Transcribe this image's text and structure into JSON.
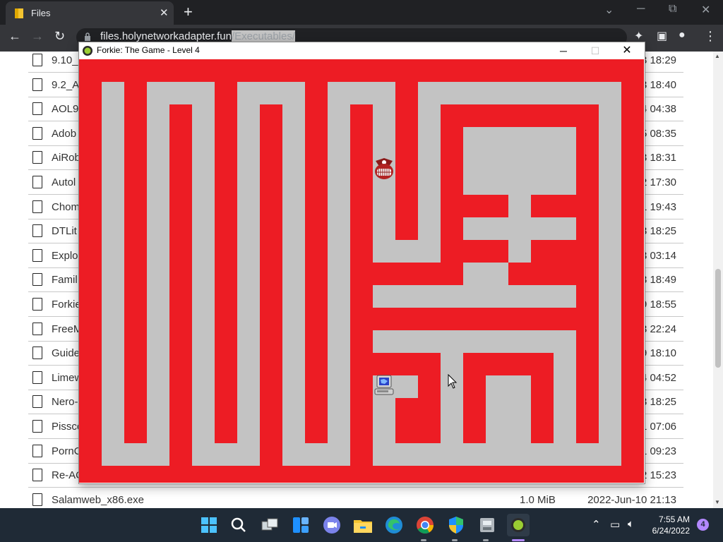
{
  "browser": {
    "tab_title": "Files",
    "tab_close": "✕",
    "new_tab": "+",
    "url_host": "files.holynetworkadapter.fun",
    "url_path": "/Executables/",
    "back": "←",
    "forward": "→",
    "reload": "↻",
    "share_icon": "⇪",
    "star_icon": "☆",
    "ext_icon": "✦",
    "sidebar_icon": "▣",
    "profile_icon": "●",
    "menu_icon": "⋮",
    "win_min": "─",
    "win_max": "⧉",
    "win_close": "✕",
    "win_chevron": "⌄"
  },
  "files": [
    {
      "name": "9.10_",
      "size": "",
      "date": "3 18:29"
    },
    {
      "name": "9.2_A",
      "size": "",
      "date": "3 18:40"
    },
    {
      "name": "AOL9",
      "size": "",
      "date": "4 04:38"
    },
    {
      "name": "Adob",
      "size": "",
      "date": "5 08:35"
    },
    {
      "name": "AiRob",
      "size": "",
      "date": "3 18:31"
    },
    {
      "name": "Autol",
      "size": "",
      "date": "2 17:30"
    },
    {
      "name": "Chom",
      "size": "",
      "date": "1 19:43"
    },
    {
      "name": "DTLit",
      "size": "",
      "date": "3 18:25"
    },
    {
      "name": "Explo",
      "size": "",
      "date": "3 03:14"
    },
    {
      "name": "Famil",
      "size": "",
      "date": "3 18:49"
    },
    {
      "name": "Forkie",
      "size": "",
      "date": "9 18:55"
    },
    {
      "name": "FreeM",
      "size": "",
      "date": "3 22:24"
    },
    {
      "name": "Guide",
      "size": "",
      "date": "9 18:10"
    },
    {
      "name": "Limew",
      "size": "",
      "date": "4 04:52"
    },
    {
      "name": "Nero-",
      "size": "",
      "date": "3 18:25"
    },
    {
      "name": "Pissco",
      "size": "",
      "date": "1 07:06"
    },
    {
      "name": "PornC",
      "size": "",
      "date": "1 09:23"
    },
    {
      "name": "Re-AC",
      "size": "",
      "date": "2 15:23"
    },
    {
      "name": "Salamweb_x86.exe",
      "size": "1.0 MiB",
      "date": "2022-Jun-10 21:13"
    }
  ],
  "game": {
    "title": "Forkie: The Game - Level 4",
    "min": "─",
    "max": "☐",
    "close": "✕"
  },
  "taskbar": {
    "time": "7:55 AM",
    "date": "6/24/2022",
    "notifications": "4",
    "apps": [
      "windows-start",
      "search",
      "task-view",
      "widgets",
      "teams-chat",
      "file-explorer",
      "edge",
      "chrome",
      "windows-security",
      "system-tool",
      "forkie-game"
    ]
  },
  "colors": {
    "maze_wall": "#ed1c24",
    "maze_path": "#c3c3c3",
    "browser_dark": "#202124"
  }
}
